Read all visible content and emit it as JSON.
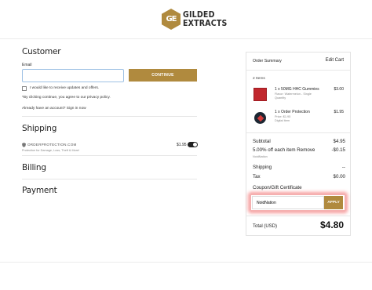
{
  "brand": {
    "logo_mark": "GE",
    "line1": "GILDED",
    "line2": "EXTRACTS"
  },
  "customer": {
    "heading": "Customer",
    "email_label": "Email",
    "email_value": "",
    "continue_label": "CONTINUE",
    "opt_in_label": "I would like to receive updates and offers.",
    "policy_note": "*By clicking continue, you agree to our privacy policy.",
    "signin_note": "Already have an account? Sign in now"
  },
  "shipping": {
    "heading": "Shipping",
    "protection_brand": "ORDERPROTECTION.COM",
    "protection_desc": "Protection for Damage, Loss, Theft & More!",
    "protection_price": "$1.95",
    "protection_enabled": true
  },
  "billing": {
    "heading": "Billing"
  },
  "payment": {
    "heading": "Payment"
  },
  "summary": {
    "title": "Order Summary",
    "edit_label": "Edit Cart",
    "items_count": "2 Items",
    "items": [
      {
        "name": "1 x 50MG HHC Gummies",
        "detail1": "Flavor: Watermelon - Single",
        "detail2": "Quantity",
        "price": "$3.00",
        "thumb": "red-gummy-pack"
      },
      {
        "name": "1 x Order Protection",
        "detail1": "Price: $1.95",
        "detail2": "Digital Item",
        "price": "$1.95",
        "thumb": "order-protection-badge"
      }
    ],
    "subtotal_label": "Subtotal",
    "subtotal_value": "$4.95",
    "discount_label": "5.00% off each item Remove",
    "discount_code": "NoidNation",
    "discount_value": "-$0.15",
    "shipping_label": "Shipping",
    "shipping_value": "--",
    "tax_label": "Tax",
    "tax_value": "$0.00",
    "coupon_label": "Coupon/Gift Certificate",
    "coupon_value": "NoidNation",
    "apply_label": "APPLY",
    "total_label": "Total (USD)",
    "total_value": "$4.80"
  },
  "colors": {
    "accent": "#b08a3e",
    "highlight": "#f05050"
  }
}
